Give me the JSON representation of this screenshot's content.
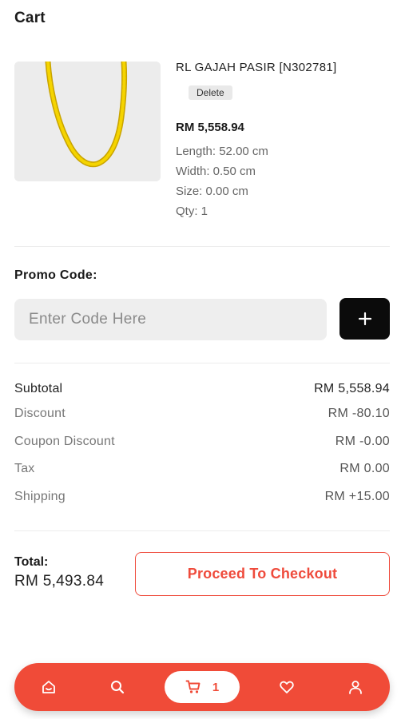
{
  "header": {
    "title": "Cart"
  },
  "item": {
    "name": "RL GAJAH PASIR [N302781]",
    "delete_label": "Delete",
    "price": "RM 5,558.94",
    "length": "Length: 52.00 cm",
    "width": "Width: 0.50 cm",
    "size": "Size: 0.00 cm",
    "qty": "Qty: 1"
  },
  "promo": {
    "label": "Promo Code:",
    "placeholder": "Enter Code Here",
    "add_icon": "plus-icon"
  },
  "summary": {
    "rows": [
      {
        "label": "Subtotal",
        "value": "RM 5,558.94"
      },
      {
        "label": "Discount",
        "value": "RM -80.10"
      },
      {
        "label": "Coupon Discount",
        "value": "RM -0.00"
      },
      {
        "label": "Tax",
        "value": "RM 0.00"
      },
      {
        "label": "Shipping",
        "value": "RM +15.00"
      }
    ]
  },
  "total": {
    "label": "Total:",
    "value": "RM 5,493.84",
    "checkout_label": "Proceed To Checkout"
  },
  "nav": {
    "items": [
      "home-icon",
      "search-icon",
      "cart-icon",
      "heart-icon",
      "user-icon"
    ],
    "cart_count": "1"
  },
  "colors": {
    "accent": "#f04b38",
    "dark_button": "#0b0b0b",
    "image_bg": "#ececec"
  }
}
